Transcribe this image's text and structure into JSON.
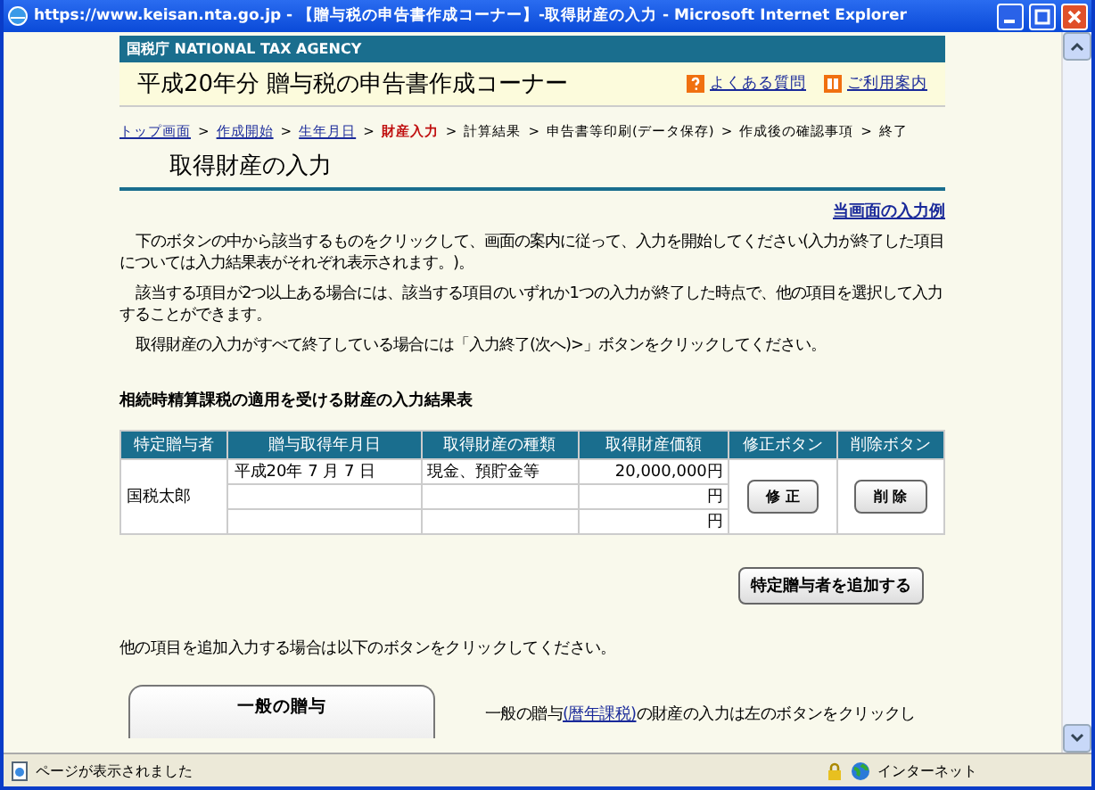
{
  "window": {
    "title": "https://www.keisan.nta.go.jp - 【贈与税の申告書作成コーナー】-取得財産の入力 - Microsoft Internet Explorer"
  },
  "agency": "国税庁 NATIONAL TAX AGENCY",
  "header": {
    "title": "平成20年分 贈与税の申告書作成コーナー",
    "links": [
      {
        "label": "よくある質問",
        "kind": "faq"
      },
      {
        "label": "ご利用案内",
        "kind": "guide"
      }
    ]
  },
  "breadcrumb": [
    {
      "label": "トップ画面",
      "kind": "link"
    },
    {
      "label": ">",
      "kind": "separator"
    },
    {
      "label": "作成開始",
      "kind": "link"
    },
    {
      "label": ">",
      "kind": "separator"
    },
    {
      "label": "生年月日",
      "kind": "link"
    },
    {
      "label": ">",
      "kind": "separator"
    },
    {
      "label": "財産入力",
      "kind": "current"
    },
    {
      "label": ">",
      "kind": "separator"
    },
    {
      "label": "計算結果",
      "kind": "plain"
    },
    {
      "label": ">",
      "kind": "separator"
    },
    {
      "label": "申告書等印刷(データ保存)",
      "kind": "plain"
    },
    {
      "label": ">",
      "kind": "separator"
    },
    {
      "label": "作成後の確認事項",
      "kind": "plain"
    },
    {
      "label": ">",
      "kind": "separator"
    },
    {
      "label": "終了",
      "kind": "plain"
    }
  ],
  "page_title": "取得財産の入力",
  "example_link": "当画面の入力例",
  "paragraphs": [
    "下のボタンの中から該当するものをクリックして、画面の案内に従って、入力を開始してください(入力が終了した項目については入力結果表がそれぞれ表示されます。)。",
    "該当する項目が2つ以上ある場合には、該当する項目のいずれか1つの入力が終了した時点で、他の項目を選択して入力することができます。",
    "取得財産の入力がすべて終了している場合には「入力終了(次へ)>」ボタンをクリックしてください。"
  ],
  "table": {
    "title": "相続時精算課税の適用を受ける財産の入力結果表",
    "columns": [
      "特定贈与者",
      "贈与取得年月日",
      "取得財産の種類",
      "取得財産価額",
      "修正ボタン",
      "削除ボタン"
    ],
    "rows": [
      {
        "giver": "国税太郎",
        "entries": [
          {
            "date": "平成20年 7 月 7 日",
            "type": "現金、預貯金等",
            "value": "20,000,000円"
          },
          {
            "value": "円"
          },
          {
            "value": "円"
          }
        ],
        "edit_button": "修 正",
        "delete_button": "削 除"
      }
    ]
  },
  "add_button": "特定贈与者を追加する",
  "other_text": "他の項目を追加入力する場合は以下のボタンをクリックしてください。",
  "general_button": "一般の贈与",
  "general_text": {
    "before": "一般の贈与",
    "link": "(暦年課税)",
    "after": "の財産の入力は左のボタンをクリックし"
  },
  "status_bar": {
    "message": "ページが表示されました",
    "zone": "インターネット"
  }
}
